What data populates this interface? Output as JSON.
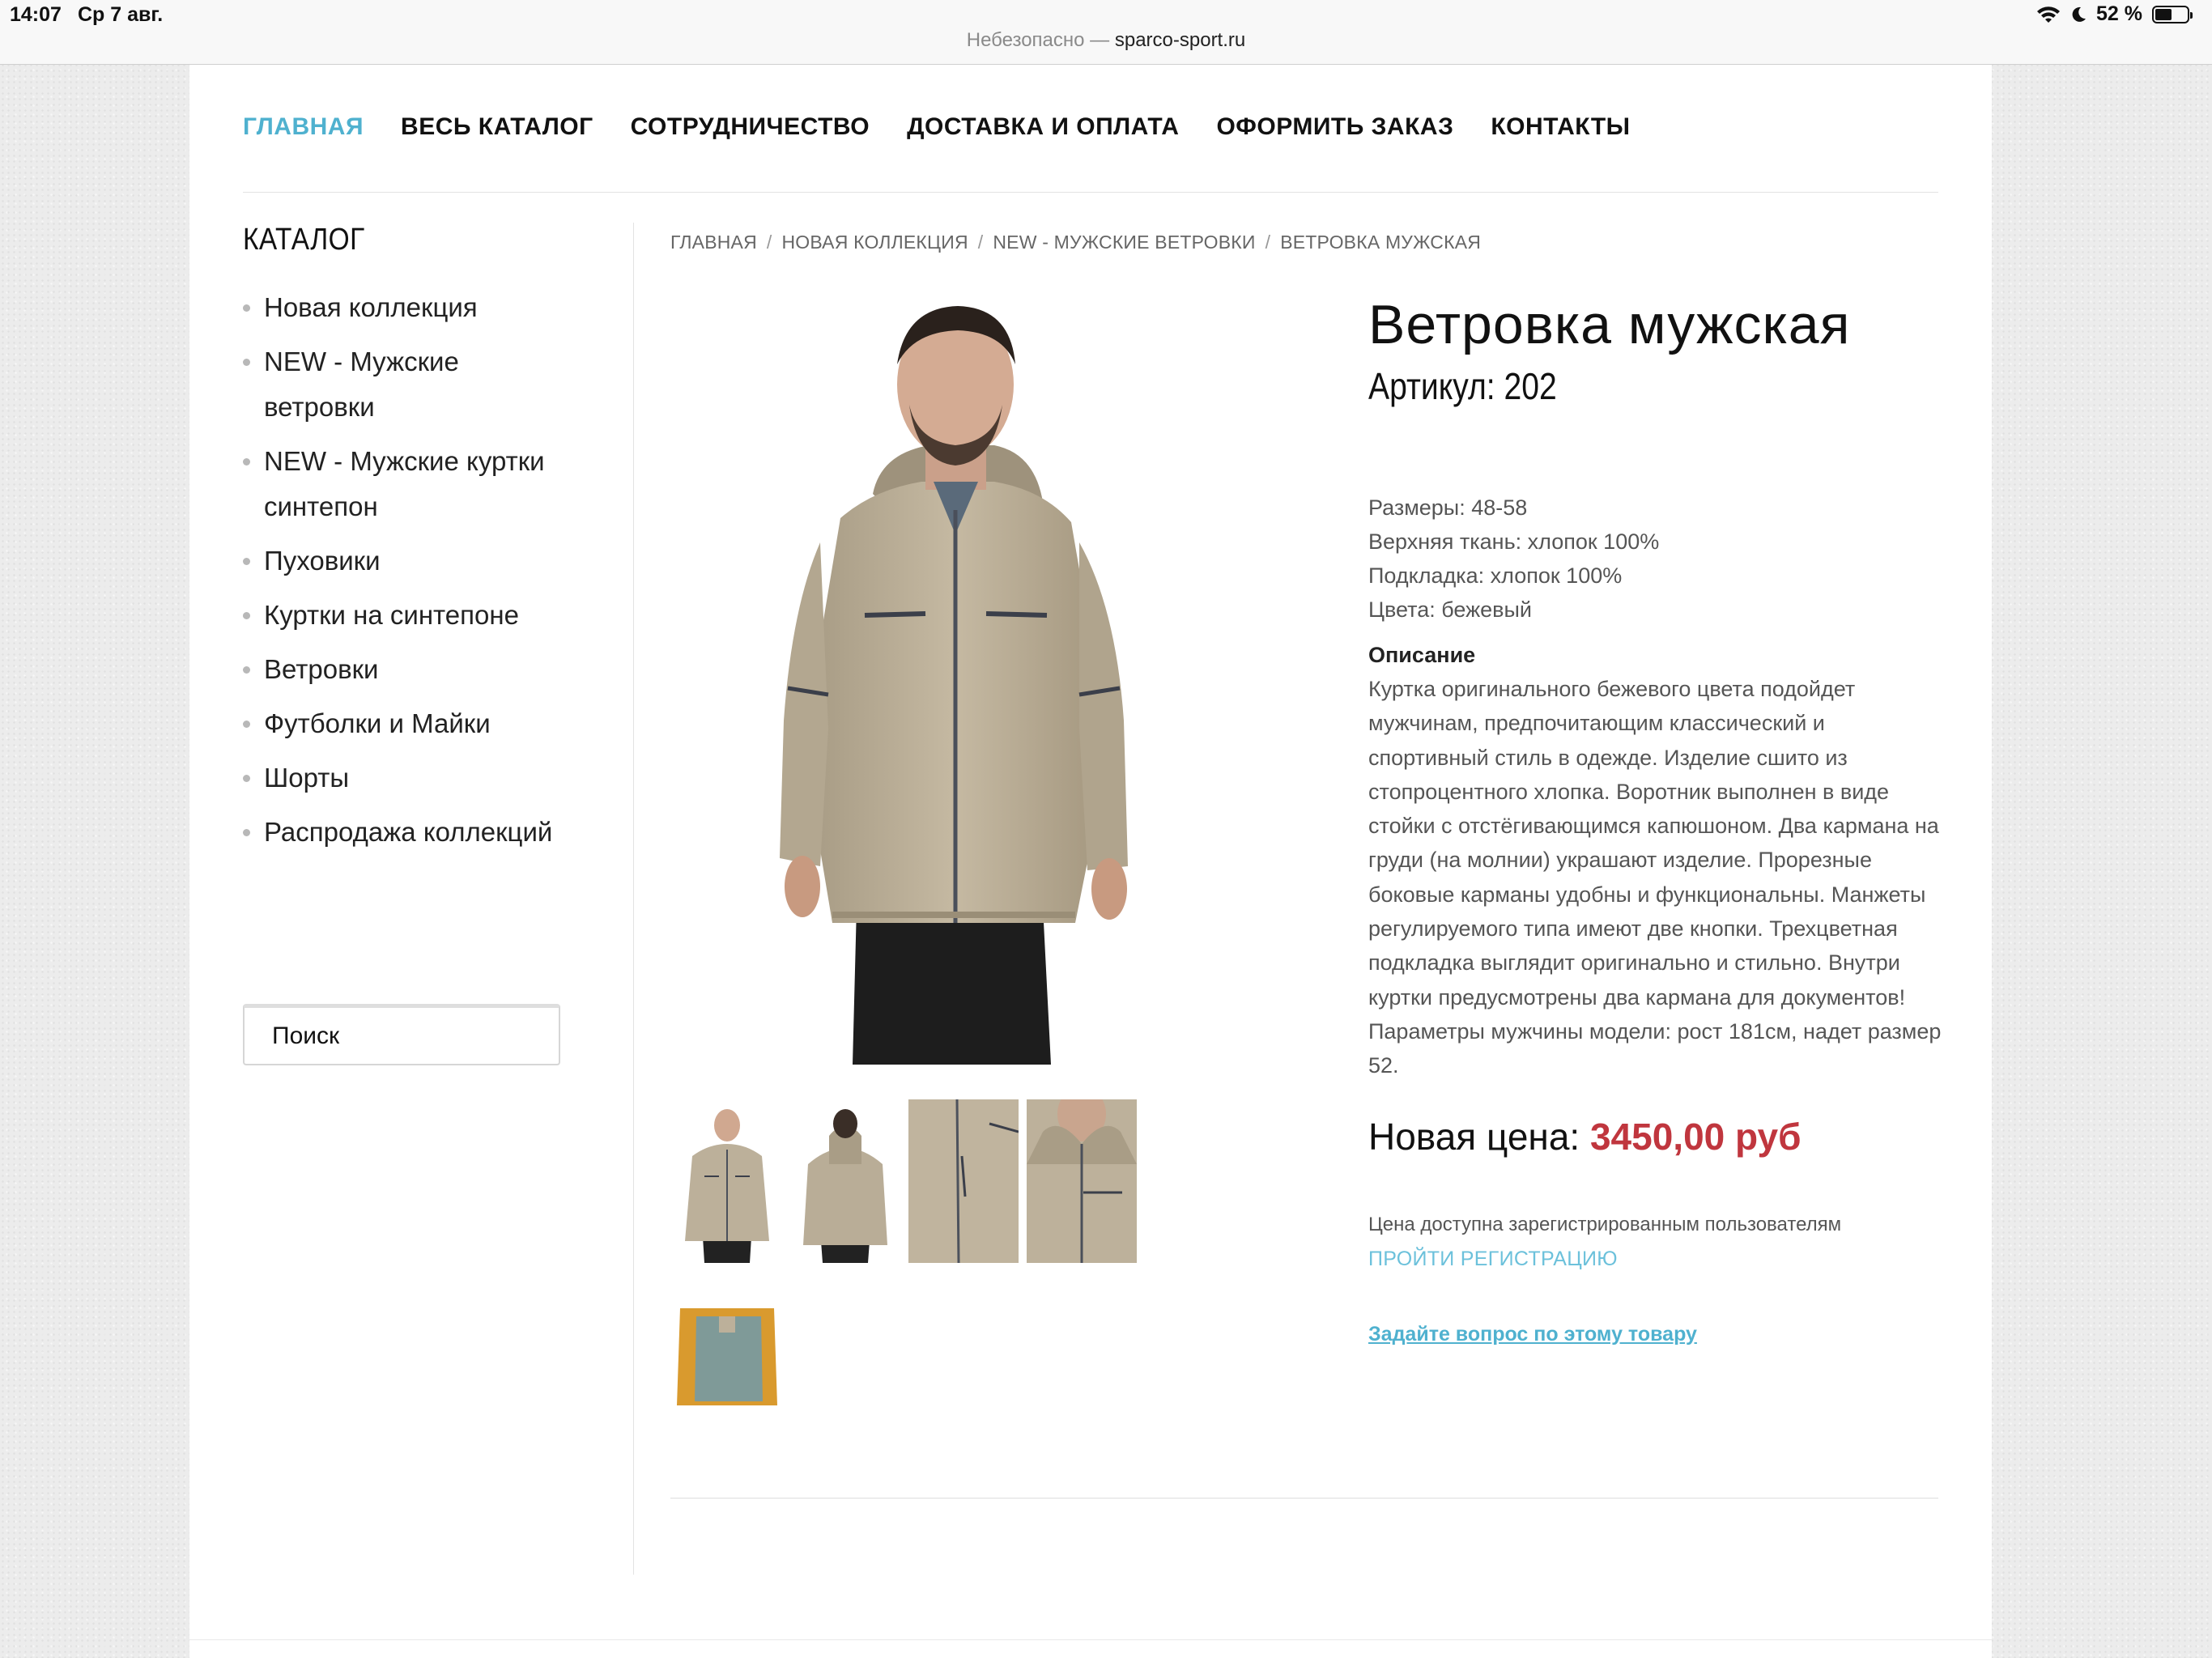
{
  "status_bar": {
    "time": "14:07",
    "date": "Ср 7 авг.",
    "battery": "52 %",
    "battery_level": 0.52,
    "url_prefix": "Небезопасно —",
    "url_host": "sparco-sport.ru"
  },
  "nav": {
    "items": [
      {
        "label": "ГЛАВНАЯ",
        "active": true
      },
      {
        "label": "ВЕСЬ КАТАЛОГ"
      },
      {
        "label": "СОТРУДНИЧЕСТВО"
      },
      {
        "label": "ДОСТАВКА И ОПЛАТА"
      },
      {
        "label": "ОФОРМИТЬ ЗАКАЗ"
      },
      {
        "label": "КОНТАКТЫ"
      }
    ]
  },
  "sidebar": {
    "title": "КАТАЛОГ",
    "items": [
      "Новая коллекция",
      "NEW - Мужские ветровки",
      "NEW - Мужские куртки синтепон",
      "Пуховики",
      "Куртки на синтепоне",
      "Ветровки",
      "Футболки и Майки",
      "Шорты",
      "Распродажа коллекций"
    ],
    "search_placeholder": "Поиск"
  },
  "breadcrumb": [
    "ГЛАВНАЯ",
    "НОВАЯ КОЛЛЕКЦИЯ",
    "NEW - МУЖСКИЕ ВЕТРОВКИ",
    "ВЕТРОВКА МУЖСКАЯ"
  ],
  "product": {
    "title": "Ветровка мужская",
    "sku": "Артикул: 202",
    "specs": [
      "Размеры: 48-58",
      "Верхняя ткань: хлопок 100%",
      "Подкладка: хлопок 100%",
      "Цвета: бежевый"
    ],
    "description_title": "Описание",
    "description_lines": [
      "Куртка оригинального бежевого цвета подойдет",
      "мужчинам, предпочитающим классический и",
      "спортивный стиль в одежде. Изделие сшито из",
      "стопроцентного хлопка. Воротник выполнен в виде",
      "стойки с отстёгивающимся капюшоном. Два кармана на",
      "груди  (на молнии) украшают изделие. Прорезные",
      "боковые карманы удобны и функциональны. Манжеты",
      "регулируемого типа имеют две кнопки. Трехцветная",
      "подкладка выглядит оригинально и стильно. Внутри",
      "куртки предусмотрены два кармана для документов!",
      "Параметры мужчины модели: рост 181см, надет размер",
      "52."
    ],
    "price_label": "Новая цена:",
    "price_value": "3450,00 руб",
    "price_note": "Цена доступна зарегистрированным пользователям",
    "register_link": "ПРОЙТИ РЕГИСТРАЦИЮ",
    "ask_link": "Задайте вопрос по этому товару",
    "colors": {
      "accent": "#4fb1cf",
      "price": "#c0363e",
      "jacket": "#bfb29b"
    }
  }
}
